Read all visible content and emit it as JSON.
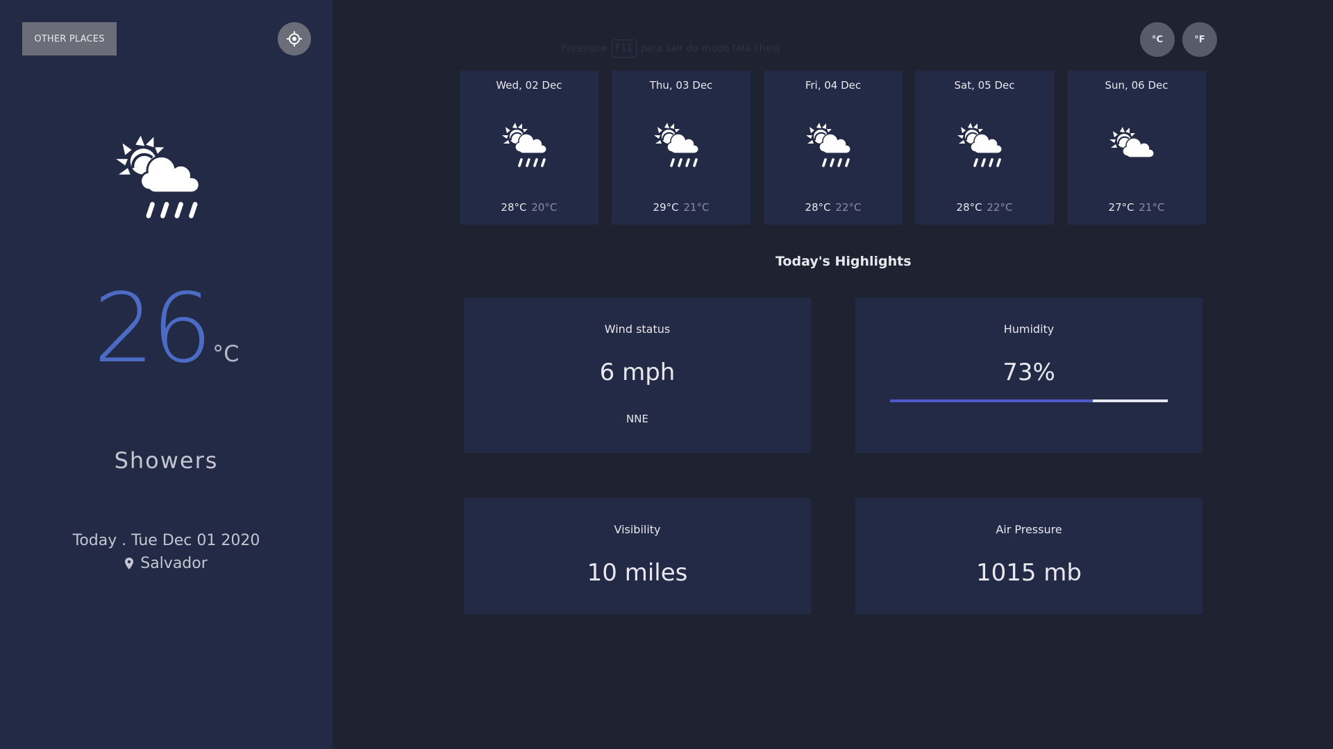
{
  "sidebar": {
    "other_places_label": "OTHER PLACES",
    "locate_icon": "crosshair-icon",
    "current": {
      "icon": "showers-icon",
      "temperature": "26",
      "unit": "°C",
      "condition": "Showers",
      "date_line": "Today . Tue Dec 01 2020",
      "location_icon": "map-pin-icon",
      "location": "Salvador"
    }
  },
  "hint": {
    "before": "Pressione",
    "key": "F11",
    "after": "para sair do modo tela cheia"
  },
  "units": {
    "celsius_label": "°C",
    "fahrenheit_label": "°F"
  },
  "forecast": [
    {
      "date": "Wed, 02 Dec",
      "icon": "showers-icon",
      "max": "28°C",
      "min": "20°C"
    },
    {
      "date": "Thu, 03 Dec",
      "icon": "showers-icon",
      "max": "29°C",
      "min": "21°C"
    },
    {
      "date": "Fri, 04 Dec",
      "icon": "showers-icon",
      "max": "28°C",
      "min": "22°C"
    },
    {
      "date": "Sat, 05 Dec",
      "icon": "showers-icon",
      "max": "28°C",
      "min": "22°C"
    },
    {
      "date": "Sun, 06 Dec",
      "icon": "light-cloud-icon",
      "max": "27°C",
      "min": "21°C"
    }
  ],
  "highlights": {
    "title": "Today's Highlights",
    "wind": {
      "label": "Wind status",
      "value": "6 mph",
      "direction": "NNE"
    },
    "humidity": {
      "label": "Humidity",
      "value": "73%",
      "percent": 73
    },
    "visibility": {
      "label": "Visibility",
      "value": "10 miles"
    },
    "pressure": {
      "label": "Air Pressure",
      "value": "1015 mb"
    }
  },
  "colors": {
    "accent": "#4b6bc4",
    "sidebar_bg": "#232a45",
    "page_bg": "#1e2231",
    "humidity_fill": "#5059c9"
  }
}
